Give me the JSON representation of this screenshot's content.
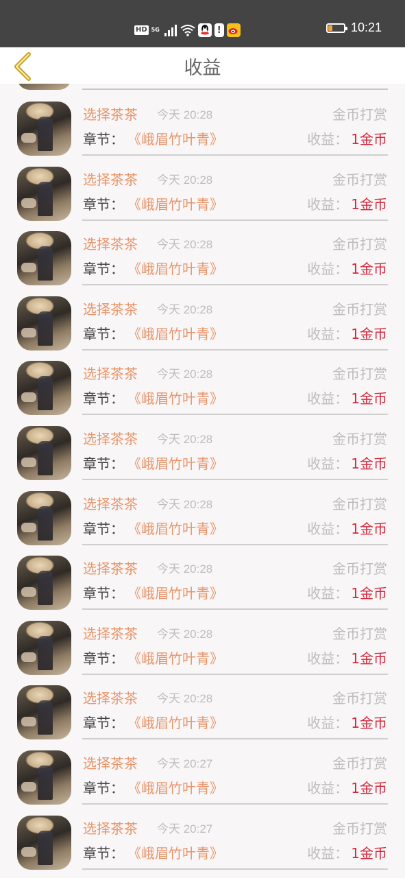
{
  "status_bar": {
    "network_badge": "HD",
    "network_type": "5G",
    "time": "10:21",
    "battery_level": 0.25,
    "battery_color": "#f0a23b"
  },
  "nav": {
    "title": "收益",
    "back_icon": "chevron-left-icon",
    "back_color": "#c8a020"
  },
  "colors": {
    "name": "#e8956a",
    "chapter": "#e8956a",
    "amount": "#d6283c",
    "muted": "#bdbdbd"
  },
  "rows": [
    {
      "name": "选择茶茶",
      "time": "今天 20:28",
      "type": "金币打赏",
      "chapter_label": "章节：",
      "chapter": "《峨眉竹叶青》",
      "income_label": "收益：",
      "income": "1金币"
    },
    {
      "name": "选择茶茶",
      "time": "今天 20:28",
      "type": "金币打赏",
      "chapter_label": "章节：",
      "chapter": "《峨眉竹叶青》",
      "income_label": "收益：",
      "income": "1金币"
    },
    {
      "name": "选择茶茶",
      "time": "今天 20:28",
      "type": "金币打赏",
      "chapter_label": "章节：",
      "chapter": "《峨眉竹叶青》",
      "income_label": "收益：",
      "income": "1金币"
    },
    {
      "name": "选择茶茶",
      "time": "今天 20:28",
      "type": "金币打赏",
      "chapter_label": "章节：",
      "chapter": "《峨眉竹叶青》",
      "income_label": "收益：",
      "income": "1金币"
    },
    {
      "name": "选择茶茶",
      "time": "今天 20:28",
      "type": "金币打赏",
      "chapter_label": "章节：",
      "chapter": "《峨眉竹叶青》",
      "income_label": "收益：",
      "income": "1金币"
    },
    {
      "name": "选择茶茶",
      "time": "今天 20:28",
      "type": "金币打赏",
      "chapter_label": "章节：",
      "chapter": "《峨眉竹叶青》",
      "income_label": "收益：",
      "income": "1金币"
    },
    {
      "name": "选择茶茶",
      "time": "今天 20:28",
      "type": "金币打赏",
      "chapter_label": "章节：",
      "chapter": "《峨眉竹叶青》",
      "income_label": "收益：",
      "income": "1金币"
    },
    {
      "name": "选择茶茶",
      "time": "今天 20:28",
      "type": "金币打赏",
      "chapter_label": "章节：",
      "chapter": "《峨眉竹叶青》",
      "income_label": "收益：",
      "income": "1金币"
    },
    {
      "name": "选择茶茶",
      "time": "今天 20:28",
      "type": "金币打赏",
      "chapter_label": "章节：",
      "chapter": "《峨眉竹叶青》",
      "income_label": "收益：",
      "income": "1金币"
    },
    {
      "name": "选择茶茶",
      "time": "今天 20:28",
      "type": "金币打赏",
      "chapter_label": "章节：",
      "chapter": "《峨眉竹叶青》",
      "income_label": "收益：",
      "income": "1金币"
    },
    {
      "name": "选择茶茶",
      "time": "今天 20:27",
      "type": "金币打赏",
      "chapter_label": "章节：",
      "chapter": "《峨眉竹叶青》",
      "income_label": "收益：",
      "income": "1金币"
    },
    {
      "name": "选择茶茶",
      "time": "今天 20:27",
      "type": "金币打赏",
      "chapter_label": "章节：",
      "chapter": "《峨眉竹叶青》",
      "income_label": "收益：",
      "income": "1金币"
    }
  ]
}
